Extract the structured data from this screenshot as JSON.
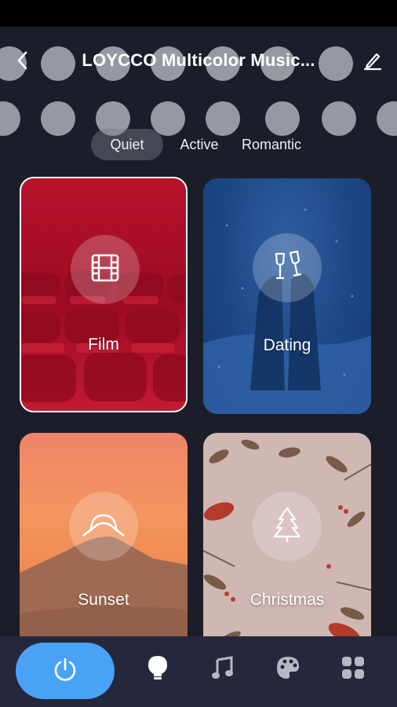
{
  "header": {
    "title": "LOYCCO Multicolor Music...",
    "back_icon": "chevron-left-icon",
    "edit_icon": "pencil-icon"
  },
  "tabs": [
    {
      "label": "Quiet",
      "active": true
    },
    {
      "label": "Active",
      "active": false
    },
    {
      "label": "Romantic",
      "active": false
    }
  ],
  "scenes": [
    {
      "label": "Film",
      "icon": "film-icon",
      "selected": true
    },
    {
      "label": "Dating",
      "icon": "champagne-glasses-icon",
      "selected": false
    },
    {
      "label": "Sunset",
      "icon": "sunset-icon",
      "selected": false
    },
    {
      "label": "Christmas",
      "icon": "christmas-tree-icon",
      "selected": false
    }
  ],
  "bottom_nav": {
    "power_icon": "power-icon",
    "items": [
      "bulb-icon",
      "music-note-icon",
      "palette-icon",
      "grid-icon"
    ]
  },
  "colors": {
    "background": "#1b1e28",
    "accent": "#4aa2f7",
    "nav_background": "#25283c"
  }
}
